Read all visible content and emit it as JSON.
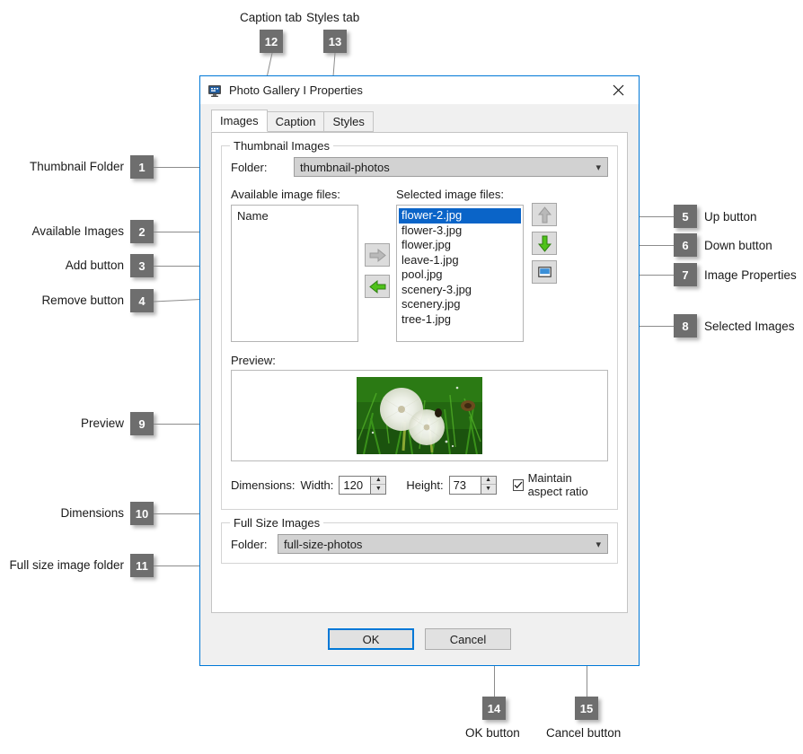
{
  "dialog": {
    "title": "Photo Gallery I Properties",
    "title_icon": "monitor-icon",
    "close_icon": "close-icon",
    "tabs": [
      {
        "label": "Images",
        "active": true
      },
      {
        "label": "Caption",
        "active": false
      },
      {
        "label": "Styles",
        "active": false
      }
    ],
    "thumbnail_group": {
      "title": "Thumbnail Images",
      "folder_label": "Folder:",
      "folder_value": "thumbnail-photos",
      "available_label": "Available image files:",
      "available_column_header": "Name",
      "available_items": [],
      "selected_label": "Selected image files:",
      "selected_items": [
        "flower-2.jpg",
        "flower-3.jpg",
        "flower.jpg",
        "leave-1.jpg",
        "pool.jpg",
        "scenery-3.jpg",
        "scenery.jpg",
        "tree-1.jpg"
      ],
      "selected_index": 0,
      "add_button_icon": "arrow-right-icon",
      "remove_button_icon": "arrow-left-icon",
      "up_button_icon": "arrow-up-icon",
      "down_button_icon": "arrow-down-icon",
      "properties_button_icon": "image-properties-icon",
      "preview_label": "Preview:",
      "preview_image_alt": "dandelion-photo",
      "dimensions_label": "Dimensions:",
      "width_label": "Width:",
      "width_value": "120",
      "height_label": "Height:",
      "height_value": "73",
      "maintain_aspect_label": "Maintain aspect ratio",
      "maintain_aspect_checked": true
    },
    "fullsize_group": {
      "title": "Full Size Images",
      "folder_label": "Folder:",
      "folder_value": "full-size-photos"
    },
    "ok_label": "OK",
    "cancel_label": "Cancel"
  },
  "callouts": [
    {
      "num": "1",
      "label": "Thumbnail Folder"
    },
    {
      "num": "2",
      "label": "Available Images"
    },
    {
      "num": "3",
      "label": "Add button"
    },
    {
      "num": "4",
      "label": "Remove button"
    },
    {
      "num": "5",
      "label": "Up button"
    },
    {
      "num": "6",
      "label": "Down button"
    },
    {
      "num": "7",
      "label": "Image Properties"
    },
    {
      "num": "8",
      "label": "Selected Images"
    },
    {
      "num": "9",
      "label": "Preview"
    },
    {
      "num": "10",
      "label": "Dimensions"
    },
    {
      "num": "11",
      "label": "Full size image folder"
    },
    {
      "num": "12",
      "label": "Caption tab"
    },
    {
      "num": "13",
      "label": "Styles tab"
    },
    {
      "num": "14",
      "label": "OK button"
    },
    {
      "num": "15",
      "label": "Cancel button"
    }
  ],
  "colors": {
    "accent": "#0078d7",
    "selection": "#0a64c8",
    "callout_badge": "#6e6e6e",
    "green_arrow": "#37a806",
    "disabled_arrow": "#b0b0b0"
  }
}
